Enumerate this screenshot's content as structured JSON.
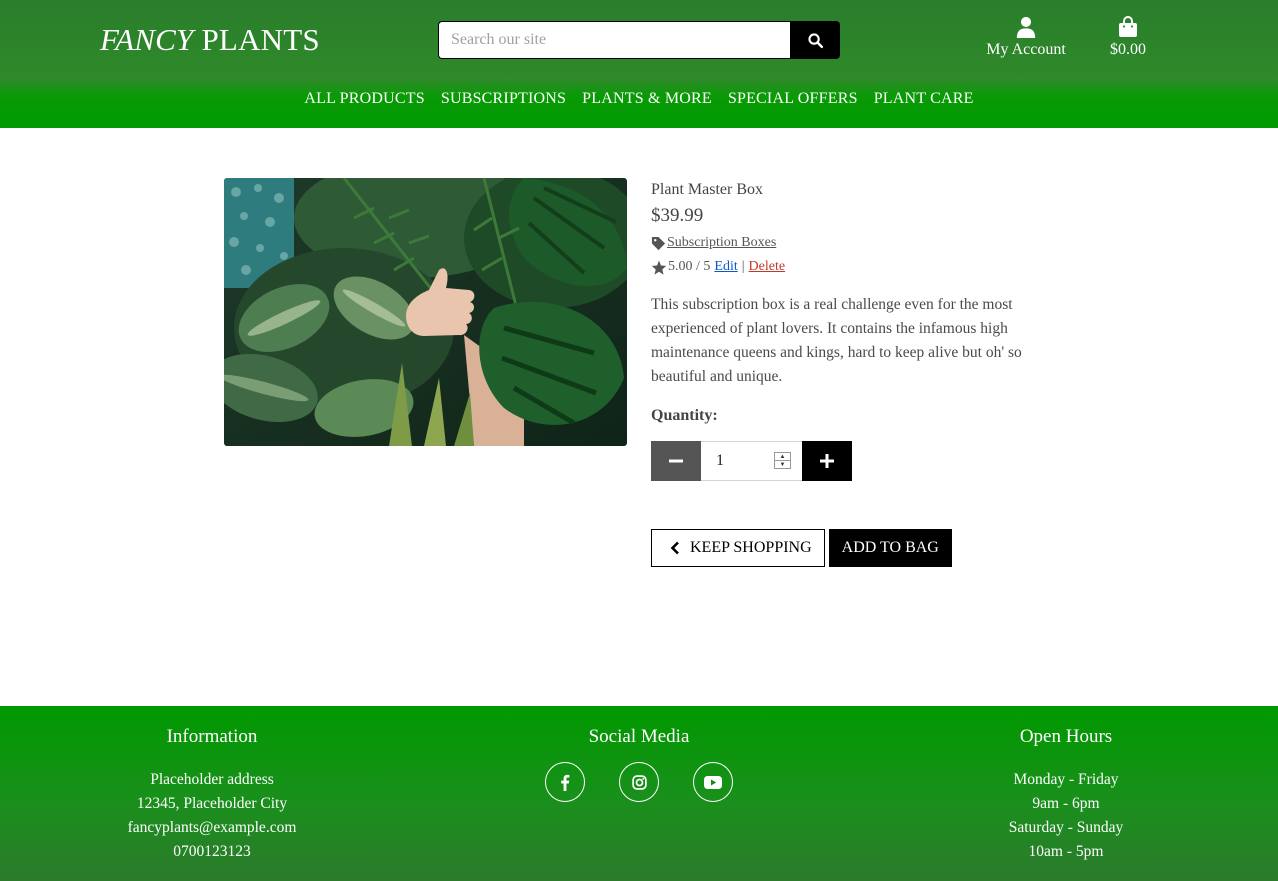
{
  "header": {
    "logo_italic": "FANCY",
    "logo_rest": "PLANTS",
    "search_placeholder": "Search our site",
    "account_label": "My Account",
    "bag_total": "$0.00",
    "nav": [
      "ALL PRODUCTS",
      "SUBSCRIPTIONS",
      "PLANTS & MORE",
      "SPECIAL OFFERS",
      "PLANT CARE"
    ]
  },
  "product": {
    "name": "Plant Master Box",
    "price": "$39.99",
    "category": "Subscription Boxes",
    "rating": "5.00 / 5",
    "edit_label": "Edit",
    "separator": "|",
    "delete_label": "Delete",
    "description": "This subscription box is a real challenge even for the most experienced of plant lovers. It contains the infamous high maintenance queens and kings, hard to keep alive but oh' so beautiful and unique.",
    "quantity_label": "Quantity:",
    "quantity_value": "1",
    "keep_shopping_label": "KEEP SHOPPING",
    "add_to_bag_label": "ADD TO BAG"
  },
  "footer": {
    "information": {
      "title": "Information",
      "lines": [
        "Placeholder address",
        "12345, Placeholder City",
        "fancyplants@example.com",
        "0700123123"
      ]
    },
    "social": {
      "title": "Social Media",
      "icons": [
        "facebook-icon",
        "instagram-icon",
        "youtube-icon"
      ]
    },
    "hours": {
      "title": "Open Hours",
      "lines": [
        "Monday - Friday",
        "9am - 6pm",
        "Saturday - Sunday",
        "10am - 5pm"
      ]
    }
  },
  "colors": {
    "header_green": "#2e8a2a",
    "nav_green": "#009900",
    "footer_green": "#009900",
    "button_dark": "#000000",
    "minus_gray": "#555555",
    "edit_blue": "#0a58ca",
    "delete_red": "#c0392b"
  }
}
